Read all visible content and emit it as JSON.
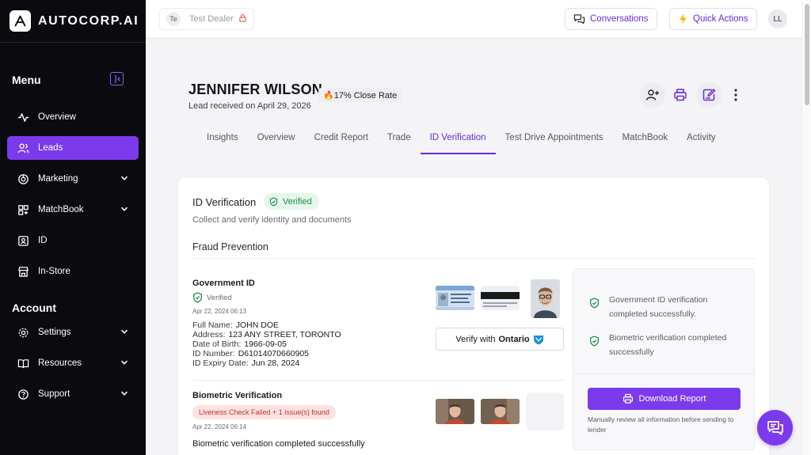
{
  "brand": {
    "name": "AUTOCORP.AI"
  },
  "sidebar": {
    "menu_heading": "Menu",
    "account_heading": "Account",
    "menu_items": [
      {
        "label": "Overview",
        "icon": "activity-icon"
      },
      {
        "label": "Leads",
        "icon": "users-icon",
        "active": true
      },
      {
        "label": "Marketing",
        "icon": "marketing-icon"
      },
      {
        "label": "MatchBook",
        "icon": "grid-icon"
      },
      {
        "label": "ID",
        "icon": "id-card-icon"
      },
      {
        "label": "In-Store",
        "icon": "store-icon"
      }
    ],
    "account_items": [
      {
        "label": "Settings",
        "icon": "gear-icon"
      },
      {
        "label": "Resources",
        "icon": "book-icon"
      },
      {
        "label": "Support",
        "icon": "help-icon"
      }
    ]
  },
  "topbar": {
    "dealer_initials": "Te",
    "dealer_name": "Test Dealer",
    "conversations_label": "Conversations",
    "quick_actions_label": "Quick Actions",
    "user_initials": "LL"
  },
  "lead": {
    "name": "JENNIFER WILSON",
    "received": "Lead received on April 29, 2026",
    "close_rate": "🔥17% Close Rate"
  },
  "tabs": [
    {
      "label": "Insights"
    },
    {
      "label": "Overview"
    },
    {
      "label": "Credit Report"
    },
    {
      "label": "Trade"
    },
    {
      "label": "ID Verification",
      "active": true
    },
    {
      "label": "Test Drive Appointments"
    },
    {
      "label": "MatchBook"
    },
    {
      "label": "Activity"
    }
  ],
  "idv": {
    "title": "ID Verification",
    "status": "Verified",
    "subtitle": "Collect and verify identity and documents",
    "fraud_title": "Fraud Prevention",
    "government_id": {
      "title": "Government ID",
      "status": "Verified",
      "timestamp": "Apr 22, 2024 06:13",
      "full_name_label": "Full Name:",
      "full_name": "JOHN DOE",
      "address_label": "Address:",
      "address": "123 ANY STREET, TORONTO",
      "dob_label": "Date of Birth:",
      "dob": "1966-09-05",
      "id_number_label": "ID Number:",
      "id_number": "D61014070660905",
      "expiry_label": "ID Expiry Date:",
      "expiry": "Jun 28, 2024",
      "verify_prefix": "Verify with",
      "verify_brand": "Ontario"
    },
    "biometric": {
      "title": "Biometric Verification",
      "issue": "Liveness Check Failed + 1 issue(s) found",
      "timestamp": "Apr 22, 2024 06:14",
      "message": "Biometric verification completed successfully"
    },
    "summary": {
      "items": [
        "Government ID verification completed successfully.",
        "Biometric verification completed successfully"
      ],
      "download_label": "Download Report",
      "note": "Manually review all information before sending to lender"
    }
  },
  "colors": {
    "accent": "#7c3aed",
    "success": "#1f8a4a",
    "danger": "#c53030",
    "sidebar_bg": "#0b0b0f"
  }
}
